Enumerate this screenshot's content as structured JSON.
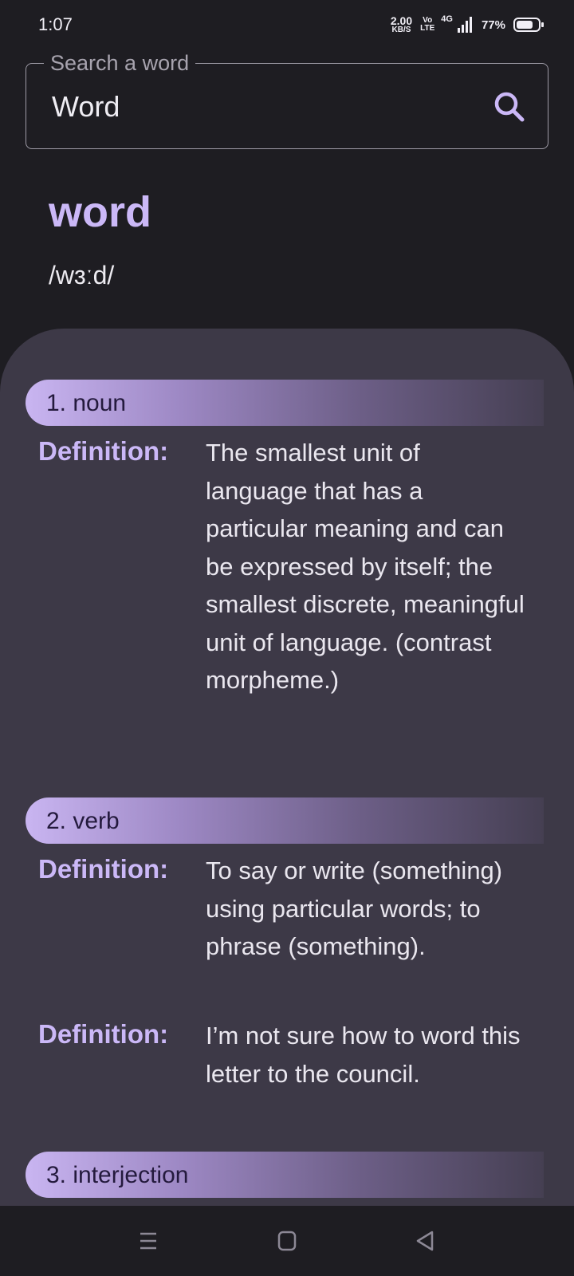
{
  "status_bar": {
    "time": "1:07",
    "net_speed_value": "2.00",
    "net_speed_unit": "KB/S",
    "volte_top": "Vo",
    "volte_bottom": "LTE",
    "network_type": "4G",
    "battery_percent": "77%",
    "battery_level": 0.77,
    "icons": [
      "signal-icon",
      "battery-icon"
    ]
  },
  "search": {
    "label": "Search a word",
    "value": "Word",
    "icon": "search-icon"
  },
  "entry": {
    "word": "word",
    "phonetic": "/wɜːd/"
  },
  "meanings": [
    {
      "label": "1. noun",
      "definitions": [
        {
          "key": "Definition:",
          "text": "The smallest unit of language that has a particular meaning and can be expressed by itself; the smallest discrete, meaningful unit of language. (contrast morpheme.)"
        }
      ]
    },
    {
      "label": "2. verb",
      "definitions": [
        {
          "key": "Definition:",
          "text": "To say or write (something) using particular words; to phrase (something)."
        },
        {
          "key": "Definition:",
          "text": "I’m not sure how to word this letter to the council."
        }
      ]
    },
    {
      "label": "3. interjection",
      "definitions": []
    }
  ],
  "nav_bar": {
    "icons": [
      "menu-icon",
      "home-icon",
      "back-icon"
    ]
  },
  "colors": {
    "background": "#1e1d22",
    "accent": "#cbb8f7",
    "card": "#3d3947",
    "text": "#eae7ef"
  }
}
